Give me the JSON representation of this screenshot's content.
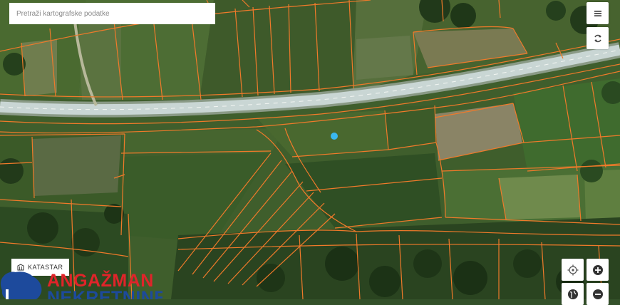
{
  "search": {
    "placeholder": "Pretraži kartografske podatke"
  },
  "controls": {
    "menu_icon": "hamburger-menu-icon",
    "refresh_icon": "refresh-icon",
    "locate_icon": "crosshair-icon",
    "zoom_in_icon": "plus-icon",
    "layers_icon": "globe-icon",
    "zoom_out_icon": "minus-icon"
  },
  "layer_button": {
    "label": "KATASTAR",
    "icon": "building-icon"
  },
  "logo": {
    "line1": "ANGAŽMAN",
    "line2": "NEKRETNINE"
  },
  "map": {
    "marker_color": "#3ab7f0",
    "parcel_line_color": "#f07a2a",
    "road_color": "#c9d6d4"
  }
}
